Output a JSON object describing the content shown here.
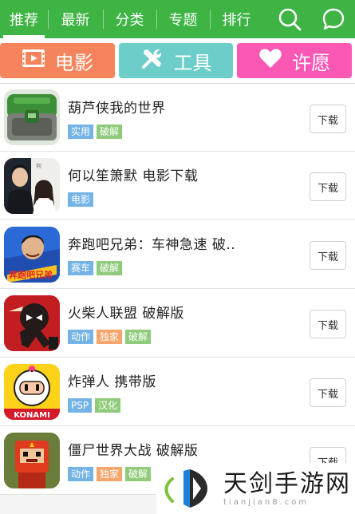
{
  "nav": {
    "tabs": [
      {
        "label": "推荐",
        "active": true
      },
      {
        "label": "最新"
      },
      {
        "label": "分类"
      },
      {
        "label": "专题"
      },
      {
        "label": "排行"
      }
    ],
    "icons": [
      "search-icon",
      "chat-bubble-icon"
    ]
  },
  "categories": [
    {
      "label": "电影",
      "icon": "film-icon",
      "color": "#f5845d"
    },
    {
      "label": "工具",
      "icon": "tools-icon",
      "color": "#6dcec9"
    },
    {
      "label": "许愿",
      "icon": "heart-icon",
      "color": "#fb57b5"
    }
  ],
  "list": {
    "download_label": "下载",
    "items": [
      {
        "title": "葫芦侠我的世界",
        "tags": [
          "实用",
          "破解"
        ]
      },
      {
        "title": "何以笙箫默  电影下载",
        "tags": [
          "电影"
        ]
      },
      {
        "title": "奔跑吧兄弟：车神急速  破..",
        "tags": [
          "赛车",
          "破解"
        ],
        "art_text": "奔跑吧兄弟"
      },
      {
        "title": "火柴人联盟  破解版",
        "tags": [
          "动作",
          "独家",
          "破解"
        ]
      },
      {
        "title": "炸弹人  携带版",
        "tags": [
          "PSP",
          "汉化"
        ],
        "art_text": "KONAMI"
      },
      {
        "title": "僵尸世界大战  破解版",
        "tags": [
          "动作",
          "独家",
          "破解"
        ]
      }
    ]
  },
  "watermark": {
    "name": "天剑手游网",
    "url": "tianjian8.com"
  },
  "colors": {
    "nav_green": "#3db443",
    "tag_blue": "#74b3e6",
    "tag_green": "#8fcb7a",
    "tag_orange": "#f5a46a"
  }
}
